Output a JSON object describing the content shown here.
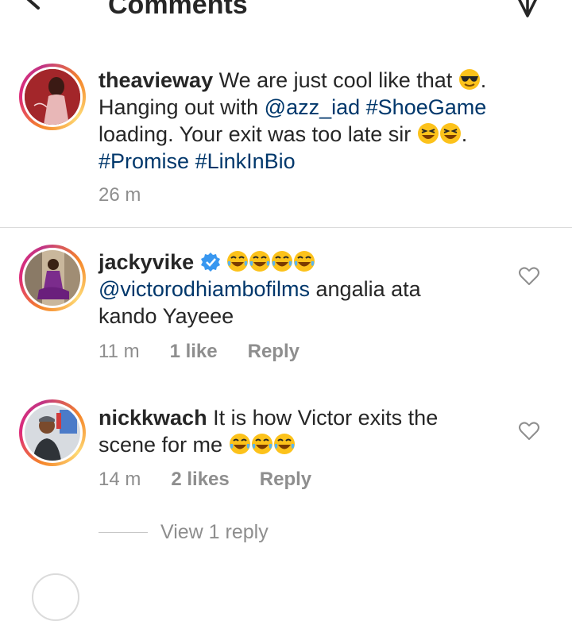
{
  "header": {
    "title": "Comments"
  },
  "caption": {
    "username": "theavieway",
    "line1": "We are just cool like that",
    "line1_end": ".",
    "line2_pre": "Hanging out with",
    "mention": "@azz_iad",
    "hashtag1": "#ShoeGame",
    "line3": "loading. Your exit was too late sir",
    "line3_end": ".",
    "hashtag2": "#Promise",
    "hashtag3": "#LinkInBio",
    "time": "26 m"
  },
  "comments": [
    {
      "username": "jackyvike",
      "mention": "@victorodhiambofilms",
      "text_after_mention": "angalia ata",
      "text_line3": "kando Yayeee",
      "time": "11 m",
      "likes": "1 like",
      "reply": "Reply"
    },
    {
      "username": "nickkwach",
      "text_line1": "It is how Victor exits the",
      "text_line2": "scene for me",
      "time": "14 m",
      "likes": "2 likes",
      "reply": "Reply",
      "view_replies": "View 1 reply"
    }
  ],
  "colors": {
    "link": "#00376b",
    "meta": "#8e8e8e",
    "verified": "#3897f0"
  }
}
